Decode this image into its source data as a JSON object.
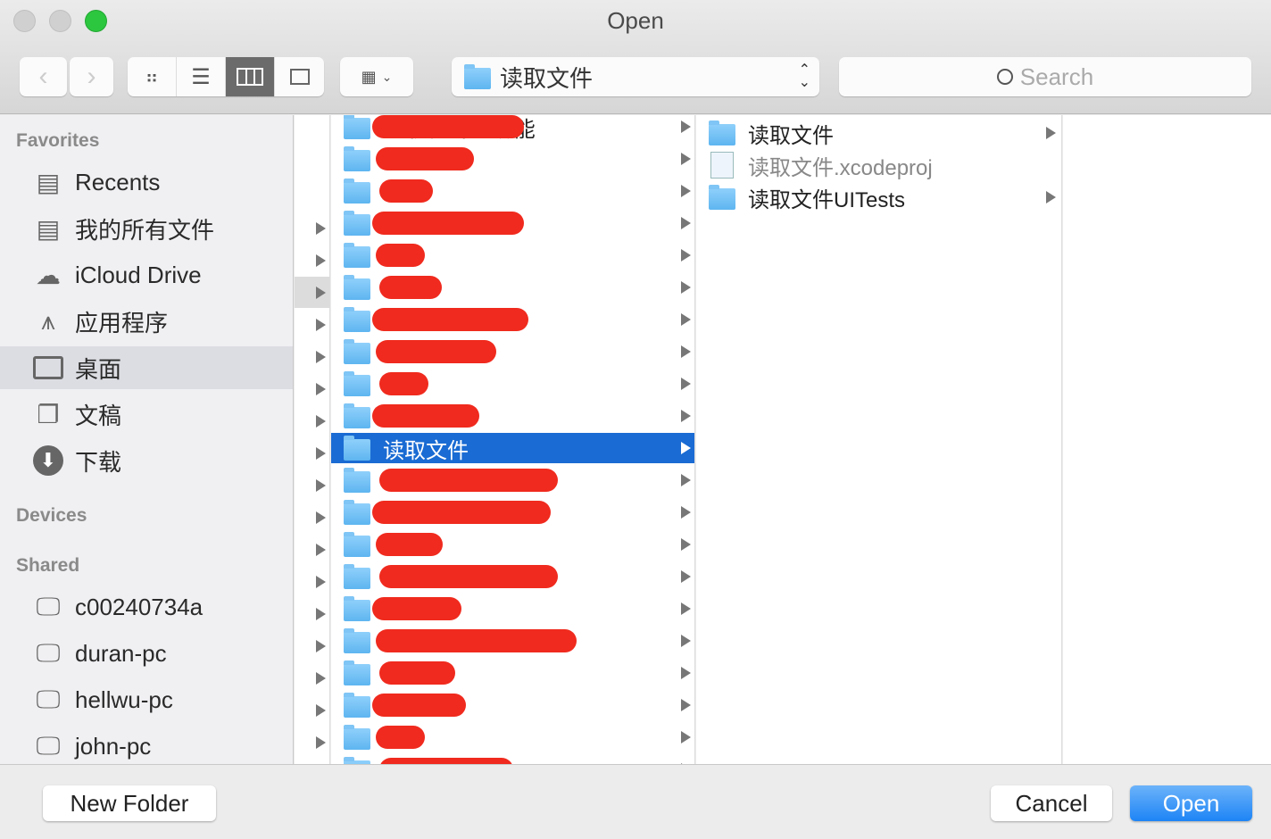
{
  "window": {
    "title": "Open"
  },
  "toolbar": {
    "back": "back-icon",
    "forward": "forward-icon",
    "views": [
      "icon-view",
      "list-view",
      "column-view",
      "coverflow-view"
    ],
    "active_view": "column-view",
    "arrange": "arrange-icon",
    "path": "读取文件",
    "search_placeholder": "Search"
  },
  "sidebar": {
    "favorites_header": "Favorites",
    "favorites": [
      {
        "label": "Recents",
        "icon": "recents-icon"
      },
      {
        "label": "我的所有文件",
        "icon": "all-files-icon"
      },
      {
        "label": "iCloud Drive",
        "icon": "cloud-icon"
      },
      {
        "label": "应用程序",
        "icon": "applications-icon"
      },
      {
        "label": "桌面",
        "icon": "desktop-icon",
        "selected": true
      },
      {
        "label": "文稿",
        "icon": "documents-icon"
      },
      {
        "label": "下载",
        "icon": "download-icon"
      }
    ],
    "devices_header": "Devices",
    "shared_header": "Shared",
    "shared": [
      {
        "label": "c00240734a",
        "icon": "computer-icon"
      },
      {
        "label": "duran-pc",
        "icon": "computer-icon"
      },
      {
        "label": "hellwu-pc",
        "icon": "computer-icon"
      },
      {
        "label": "john-pc",
        "icon": "computer-icon"
      }
    ]
  },
  "column2": {
    "items": [
      "60秒倒计时功能",
      "",
      "",
      "",
      "",
      "",
      "",
      "",
      "",
      "",
      "读取文件",
      "",
      "",
      "",
      "",
      "",
      "",
      "",
      "",
      "",
      ""
    ],
    "selected_index": 10
  },
  "column3": {
    "items": [
      {
        "label": "读取文件",
        "type": "folder",
        "has_children": true
      },
      {
        "label": "读取文件.xcodeproj",
        "type": "xcodeproj",
        "has_children": false
      },
      {
        "label": "读取文件UITests",
        "type": "folder",
        "has_children": true
      }
    ]
  },
  "footer": {
    "new_folder": "New Folder",
    "cancel": "Cancel",
    "open": "Open"
  },
  "colors": {
    "selection": "#1a6bd3",
    "redaction": "#f02a1e",
    "primary_button": "#1d84f5"
  }
}
